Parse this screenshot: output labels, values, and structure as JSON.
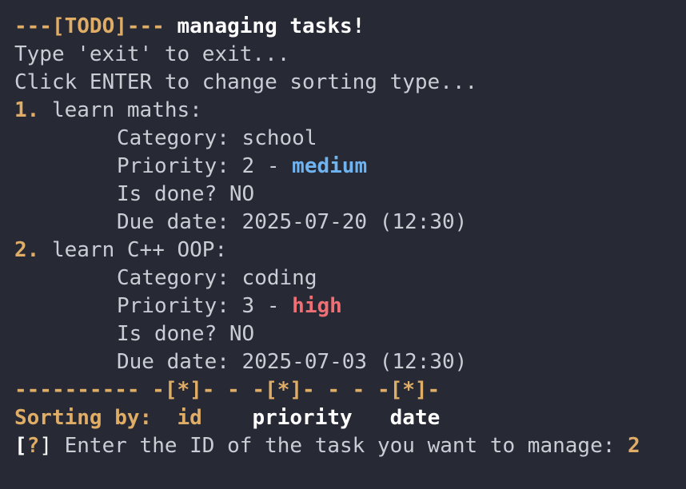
{
  "header": {
    "tag": "---[TODO]---",
    "title": "managing tasks!"
  },
  "instructions": {
    "exit_hint": "Type 'exit' to exit...",
    "sort_hint": "Click ENTER to change sorting type..."
  },
  "tasks": [
    {
      "number": "1.",
      "name": "learn maths:",
      "category_label": "Category:",
      "category": "school",
      "priority_label": "Priority:",
      "priority_value": "2 -",
      "priority_level": "medium",
      "done_label": "Is done?",
      "done": "NO",
      "due_label": "Due date:",
      "due": "2025-07-20 (12:30)"
    },
    {
      "number": "2.",
      "name": "learn C++ OOP:",
      "category_label": "Category:",
      "category": "coding",
      "priority_label": "Priority:",
      "priority_value": "3 -",
      "priority_level": "high",
      "done_label": "Is done?",
      "done": "NO",
      "due_label": "Due date:",
      "due": "2025-07-03 (12:30)"
    }
  ],
  "separator": "---------- -[*]- - -[*]- - - -[*]-",
  "sorting": {
    "label": "Sorting by:",
    "options": [
      "id",
      "priority",
      "date"
    ],
    "selected": "id"
  },
  "prompt": {
    "bracket_open": "[",
    "mark": "?",
    "bracket_close": "]",
    "text": "Enter the ID of the task you want to manage:",
    "input_value": "2"
  },
  "colors": {
    "background": "#272a34",
    "text": "#c9cdd4",
    "accent": "#e0ad66",
    "medium": "#6fb3f0",
    "high": "#ef6f74"
  }
}
